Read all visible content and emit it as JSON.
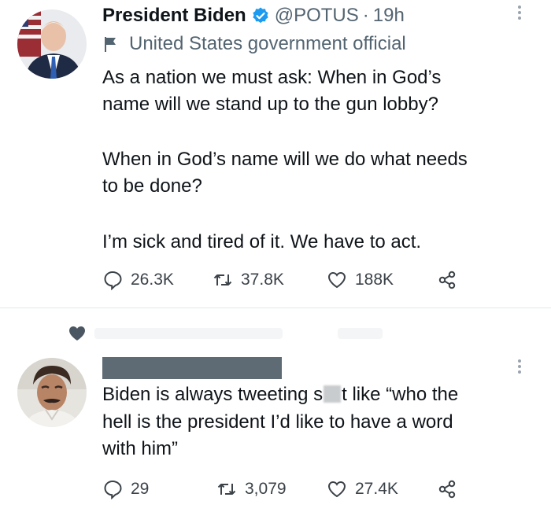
{
  "tweet1": {
    "author_name": "President Biden",
    "handle": "@POTUS",
    "separator": "·",
    "time": "19h",
    "label": "United States government official",
    "lines": [
      "As a nation we must ask: When in God’s",
      "name will we stand up to the gun lobby?",
      "When in God’s name will we do what needs",
      "to be done?",
      "I’m sick and tired of it. We have to act."
    ],
    "replies": "26.3K",
    "retweets": "37.8K",
    "likes": "188K"
  },
  "tweet2": {
    "line1_before": "Biden is always tweeting s",
    "line1_after": "t like “who the",
    "line2": "hell is the president I’d like to have a word",
    "line3": "with him”",
    "replies": "29",
    "retweets": "3,079",
    "likes": "27.4K"
  },
  "colors": {
    "text": "#0f1419",
    "secondary": "#536471",
    "verified": "#1d9bf0",
    "divider": "#e3e6e8",
    "redaction": "#5f6b74"
  },
  "icons": [
    "verified-badge-icon",
    "flag-icon",
    "reply-icon",
    "retweet-icon",
    "like-icon",
    "share-icon",
    "more-icon",
    "heart-icon"
  ]
}
